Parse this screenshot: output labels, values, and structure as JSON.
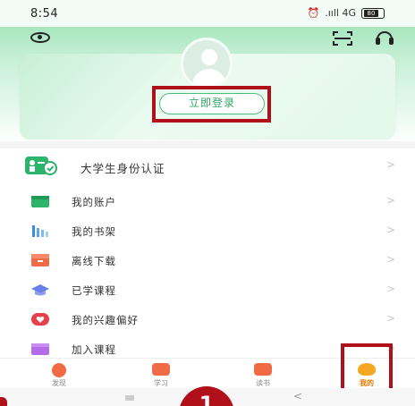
{
  "status_bar": {
    "time": "8:54",
    "signal_text": ".ııll 4G",
    "battery": "80"
  },
  "header": {
    "login_label": "立即登录"
  },
  "verify": {
    "label": "大学生身份认证",
    "chevron": ">"
  },
  "menu": {
    "items": [
      {
        "label": "我的账户",
        "icon": "wallet-icon",
        "color": "#2db36a"
      },
      {
        "label": "我的书架",
        "icon": "bookshelf-icon",
        "color": "#3a8ee6"
      },
      {
        "label": "离线下载",
        "icon": "download-icon",
        "color": "#f06a45"
      },
      {
        "label": "已学课程",
        "icon": "graduation-cap-icon",
        "color": "#6b7fe8"
      },
      {
        "label": "我的兴趣偏好",
        "icon": "heart-icon",
        "color": "#e8404a"
      },
      {
        "label": "加入课程",
        "icon": "add-course-icon",
        "color": "#b56be8"
      }
    ],
    "chevron": ">"
  },
  "tabbar": {
    "tabs": [
      {
        "label": "发现",
        "icon": "discover-icon"
      },
      {
        "label": "学习",
        "icon": "study-icon"
      },
      {
        "label": "读书",
        "icon": "reading-icon"
      },
      {
        "label": "我的",
        "icon": "me-icon",
        "active": true
      }
    ]
  },
  "annotation": {
    "step_number": "1"
  },
  "colors": {
    "accent_green": "#2fa866",
    "highlight_red": "#b0101a",
    "tab_active": "#e67a00"
  }
}
